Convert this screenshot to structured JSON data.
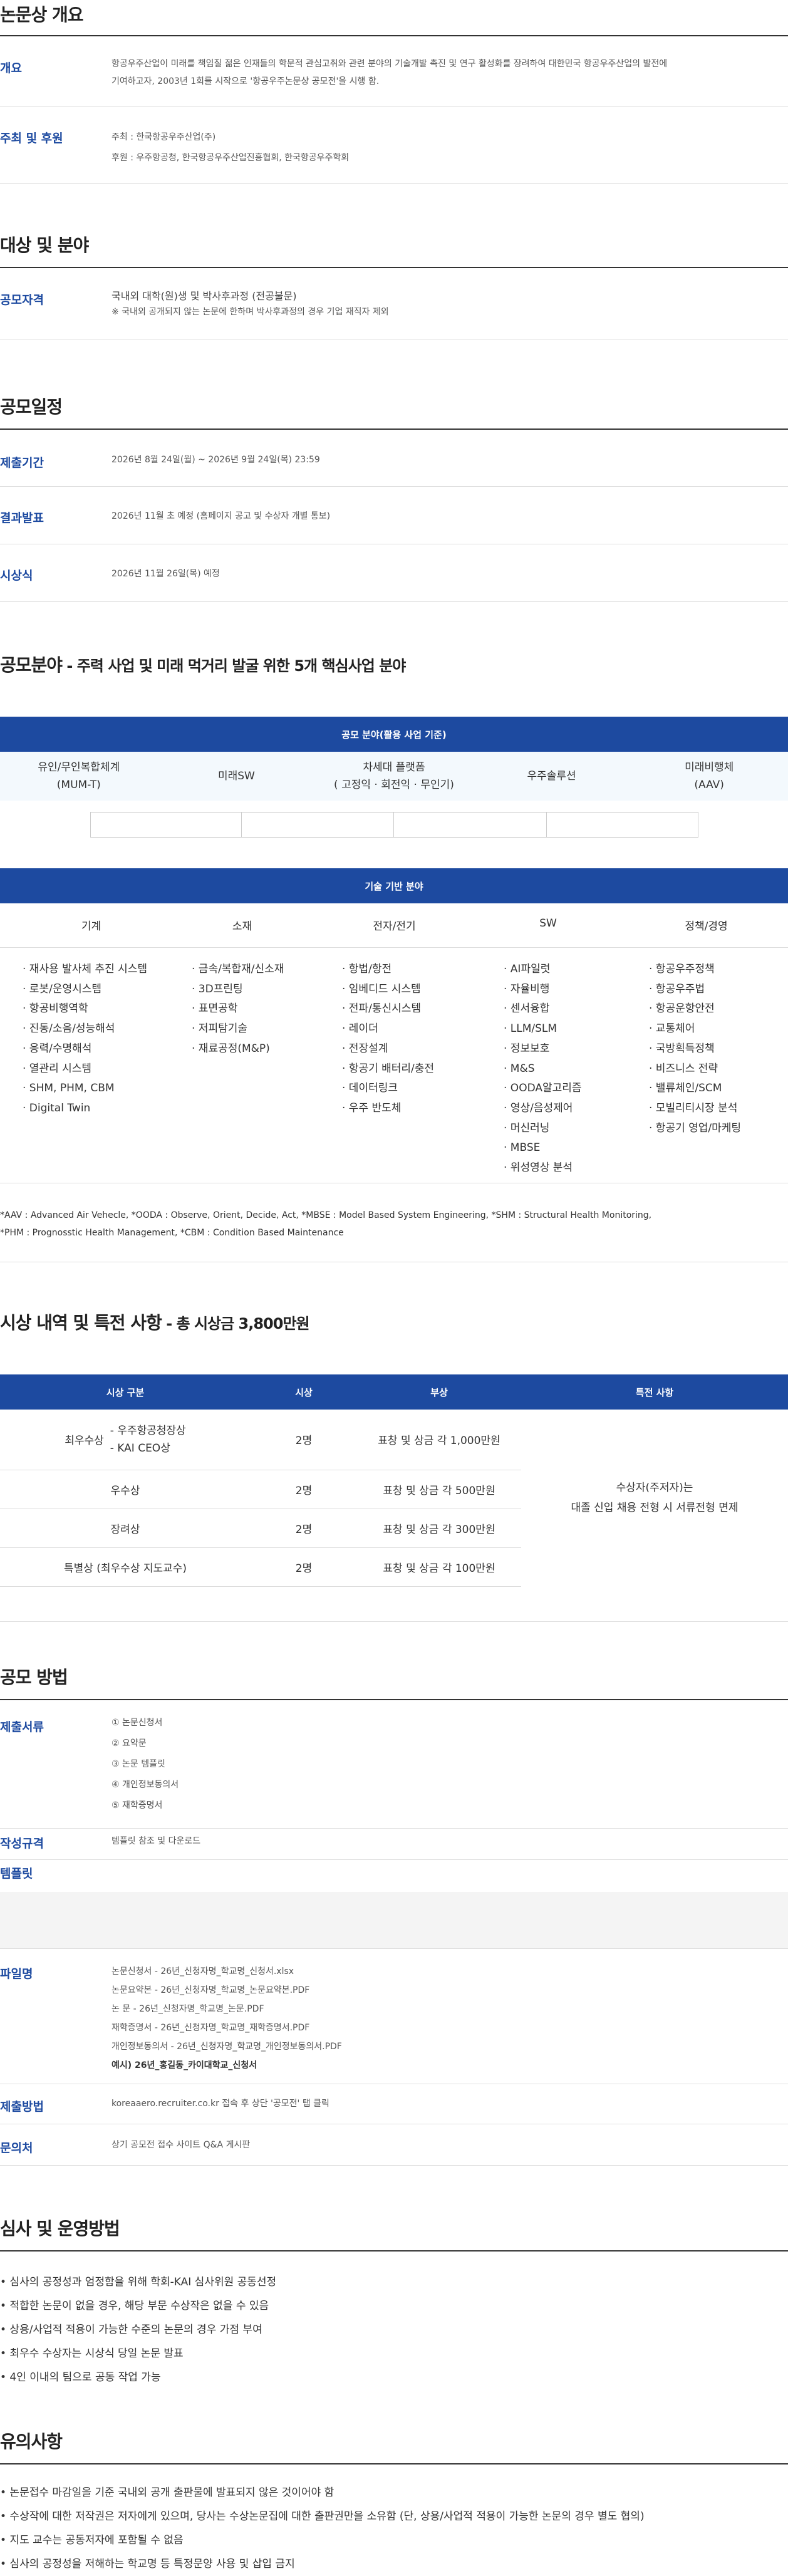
{
  "overview": {
    "title": "논문상 개요",
    "purpose_label": "개요",
    "purpose_text_1": "항공우주산업이 미래를 책임질 젊은 인재들의 학문적 관심고취와 관련 분야의 기술개발 촉진 및 연구 활성화를 장려하여 대한민국 항공우주산업의 발전에",
    "purpose_text_2": "기여하고자, 2003년 1회를 시작으로 '항공우주논문상 공모전'을 시행 함.",
    "host_label": "주최 및 후원",
    "host_text": "주최 : 한국항공우주산업(주)",
    "sponsor_text": "후원 : 우주항공청, 한국항공우주산업진흥협회, 한국항공우주학회"
  },
  "target": {
    "title": "대상 및 분야",
    "eligibility_label": "공모자격",
    "eligibility_text": "국내외 대학(원)생 및 박사후과정 (전공불문)",
    "eligibility_note": "※ 국내외 공개되지 않는 논문에 한하며 박사후과정의 경우 기업 재직자 제외"
  },
  "schedule": {
    "title": "공모일정",
    "submit_label": "제출기간",
    "submit_text": "2026년 8월 24일(월) ~ 2026년 9월 24일(목) 23:59",
    "result_label": "결과발표",
    "result_text": "2026년 11월 초 예정 (홈페이지 공고 및 수상자 개별 통보)",
    "ceremony_label": "시상식",
    "ceremony_text": "2026년 11월 26일(목) 예정"
  },
  "fields": {
    "title_main": "공모분야",
    "title_sub": " - 주력 사업 및 미래 먹거리 발굴 위한 5개 핵심사업 분야",
    "business_bar": "공모 분야(활용 사업 기준)",
    "business_cats": [
      "유인/무인복합체계\n(MUM-T)",
      "미래SW",
      "차세대 플랫폼\n( 고정익 · 회전익 · 무인기)",
      "우주솔루션",
      "미래비행체\n(AAV)"
    ],
    "tech_bar": "기술 기반 분야",
    "tech_cols": [
      {
        "head": "기계",
        "items": [
          "· 재사용 발사체 추진 시스템",
          "· 로봇/운영시스템",
          "· 항공비행역학",
          "· 진동/소음/성능해석",
          "· 응력/수명해석",
          "· 열관리 시스템",
          "· SHM, PHM, CBM",
          "· Digital Twin"
        ]
      },
      {
        "head": "소재",
        "items": [
          "· 금속/복합재/신소재",
          "· 3D프린팅",
          "· 표면공학",
          "· 저피탐기술",
          "· 재료공정(M&P)"
        ]
      },
      {
        "head": "전자/전기",
        "items": [
          "· 항법/항전",
          "· 임베디드 시스템",
          "· 전파/통신시스템",
          "· 레이더",
          "· 전장설계",
          "· 항공기 배터리/충전",
          "· 데이터링크",
          "· 우주 반도체"
        ]
      },
      {
        "head": "SW",
        "items": [
          "· AI파일럿",
          "· 자율비행",
          "· 센서융합",
          "· LLM/SLM",
          "· 정보보호",
          "· M&S",
          "· OODA알고리즘",
          "· 영상/음성제어",
          "· 머신러닝",
          "· MBSE",
          "· 위성영상 분석"
        ]
      },
      {
        "head": "정책/경영",
        "items": [
          "· 항공우주정책",
          "· 항공우주법",
          "· 항공운항안전",
          "· 교통체어",
          "· 국방획득정책",
          "· 비즈니스 전략",
          "· 밸류체인/SCM",
          "· 모빌리티시장 분석",
          "· 항공기 영업/마케팅"
        ]
      }
    ],
    "footnote_1": "*AAV : Advanced Air Vehecle, *OODA : Observe, Orient, Decide, Act, *MBSE : Model Based System Engineering, *SHM : Structural Health Monitoring,",
    "footnote_2": "*PHM : Prognosstic Health Management, *CBM : Condition Based Maintenance"
  },
  "awards": {
    "title_main": "시상 내역 및 특전 사항",
    "title_sub": " - 총 시상금 3,800만원",
    "headers": [
      "시상 구분",
      "시상",
      "부상",
      "특전 사항"
    ],
    "rows": [
      {
        "name": "최우수상",
        "sub1": "- 우주항공청장상",
        "sub2": "- KAI CEO상",
        "count": "2명",
        "prize": "표창 및 상금 각 1,000만원"
      },
      {
        "name": "우수상",
        "count": "2명",
        "prize": "표창 및 상금 각 500만원"
      },
      {
        "name": "장려상",
        "count": "2명",
        "prize": "표창 및 상금 각 300만원"
      },
      {
        "name": "특별상 (최우수상 지도교수)",
        "count": "2명",
        "prize": "표창 및 상금 각 100만원"
      }
    ],
    "benefit_1": "수상자(주저자)는",
    "benefit_2": "대졸 신입 채용 전형 시 서류전형 면제"
  },
  "method": {
    "title": "공모 방법",
    "docs_label": "제출서류",
    "docs": [
      "① 논문신청서",
      "② 요약문",
      "③ 논문 템플릿",
      "④ 개인정보동의서",
      "⑤ 재학증명서"
    ],
    "format_label": "작성규격",
    "format_text": "템플릿 참조 및 다운로드",
    "template_label": "템플릿",
    "filename_label": "파일명",
    "filenames": [
      "논문신청서 - 26년_신청자명_학교명_신청서.xlsx",
      "논문요약본 - 26년_신청자명_학교명_논문요약본.PDF",
      "논 문 - 26년_신청자명_학교명_논문.PDF",
      "재학증명서 - 26년_신청자명_학교명_재학증명서.PDF",
      "개인정보동의서 - 26년_신청자명_학교명_개인정보동의서.PDF"
    ],
    "filename_example": "예시) 26년_홍길동_카이대학교_신청서",
    "submit_label": "제출방법",
    "submit_text": "koreaaero.recruiter.co.kr 접속 후 상단 '공모전' 탭 클릭",
    "contact_label": "문의처",
    "contact_text": "상기 공모전 접수 사이트 Q&A 게시판"
  },
  "review": {
    "title": "심사 및 운영방법",
    "items": [
      "• 심사의 공정성과 엄정함을 위해 학회-KAI 심사위원 공동선정",
      "• 적합한 논문이 없을 경우, 해당 부문 수상작은 없을 수 있음",
      "• 상용/사업적 적용이 가능한 수준의 논문의 경우 가점 부여",
      "• 최우수 수상자는 시상식 당일 논문 발표",
      "• 4인 이내의 팀으로 공동 작업 가능"
    ]
  },
  "notes": {
    "title": "유의사항",
    "items": [
      "• 논문접수 마감일을 기준 국내외 공개 출판물에 발표되지 않은 것이어야 함",
      "• 수상작에 대한 저작권은 저자에게 있으며, 당사는 수상논문집에 대한 출판권만을 소유함 (단, 상용/사업적 적용이 가능한 논문의 경우 별도 협의)",
      "• 지도 교수는 공동저자에 포함될 수 없음",
      "• 심사의 공정성을 저해하는 학교명 등 특정문양 사용 및 삽입 금지"
    ]
  },
  "colors": {
    "accent": "#1d4aa0",
    "label_blue": "#1d4aa0",
    "category_bg": "#f3f9fd"
  }
}
